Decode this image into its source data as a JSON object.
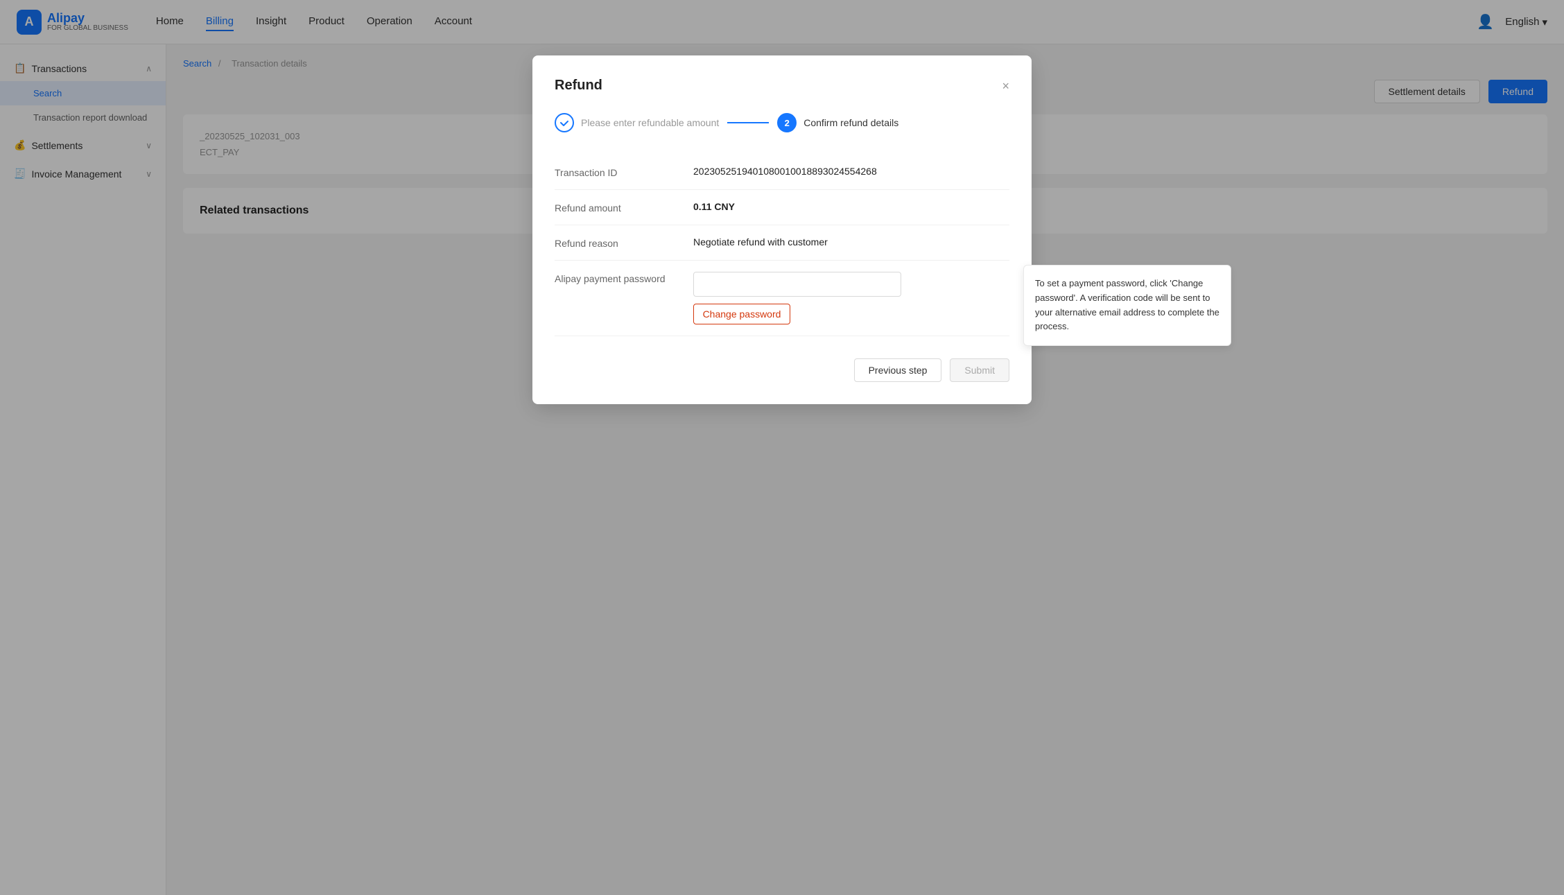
{
  "nav": {
    "logo": "A",
    "logo_main": "Alipay",
    "logo_sub": "FOR\nGLOBAL BUSINESS",
    "links": [
      {
        "label": "Home",
        "active": false
      },
      {
        "label": "Billing",
        "active": true
      },
      {
        "label": "Insight",
        "active": false
      },
      {
        "label": "Product",
        "active": false
      },
      {
        "label": "Operation",
        "active": false
      },
      {
        "label": "Account",
        "active": false
      }
    ],
    "language": "English",
    "chevron": "▾"
  },
  "sidebar": {
    "groups": [
      {
        "icon": "📋",
        "label": "Transactions",
        "expanded": true,
        "items": [
          {
            "label": "Search",
            "active": true
          },
          {
            "label": "Transaction report download",
            "active": false
          }
        ]
      },
      {
        "icon": "💰",
        "label": "Settlements",
        "expanded": false,
        "items": []
      },
      {
        "icon": "🧾",
        "label": "Invoice Management",
        "expanded": false,
        "items": []
      }
    ]
  },
  "breadcrumb": {
    "items": [
      "Search",
      "Transaction details"
    ],
    "separator": "/"
  },
  "bg_buttons": {
    "settlement": "Settlement details",
    "refund": "Refund"
  },
  "bg_content": {
    "order_id": "_20230525_102031_003",
    "pay_type": "ECT_PAY",
    "related_transactions_title": "Related transactions"
  },
  "modal": {
    "title": "Refund",
    "close_icon": "×",
    "steps": [
      {
        "label": "Please enter refundable amount",
        "status": "completed"
      },
      {
        "label": "Confirm refund details",
        "status": "active",
        "number": "2"
      }
    ],
    "fields": [
      {
        "label": "Transaction ID",
        "value": "2023052519401080010018893024554268",
        "bold": false
      },
      {
        "label": "Refund amount",
        "value": "0.11 CNY",
        "bold": true
      },
      {
        "label": "Refund reason",
        "value": "Negotiate refund with customer",
        "bold": false
      },
      {
        "label": "Alipay payment password",
        "value": "",
        "is_password": true
      }
    ],
    "change_password_btn": "Change password",
    "tooltip": "To set a payment password, click 'Change password'. A verification code will be sent to your alternative email address to complete the process.",
    "footer": {
      "previous": "Previous step",
      "submit": "Submit"
    }
  }
}
